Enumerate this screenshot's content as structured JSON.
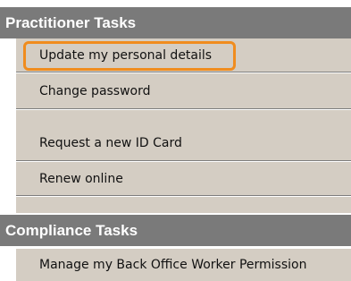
{
  "sections": [
    {
      "title": "Practitioner Tasks",
      "items": [
        {
          "label": "Update my personal details",
          "highlighted": true
        },
        {
          "label": "Change password"
        },
        {
          "label": "Request a new ID Card"
        },
        {
          "label": "Renew online"
        }
      ]
    },
    {
      "title": "Compliance Tasks",
      "items": [
        {
          "label": "Manage my Back Office Worker Permission"
        }
      ]
    }
  ],
  "colors": {
    "header_bg": "#7a7a7a",
    "item_bg": "#d4cdc3",
    "highlight": "#f08c1e",
    "divider": "#7d7d7d"
  }
}
